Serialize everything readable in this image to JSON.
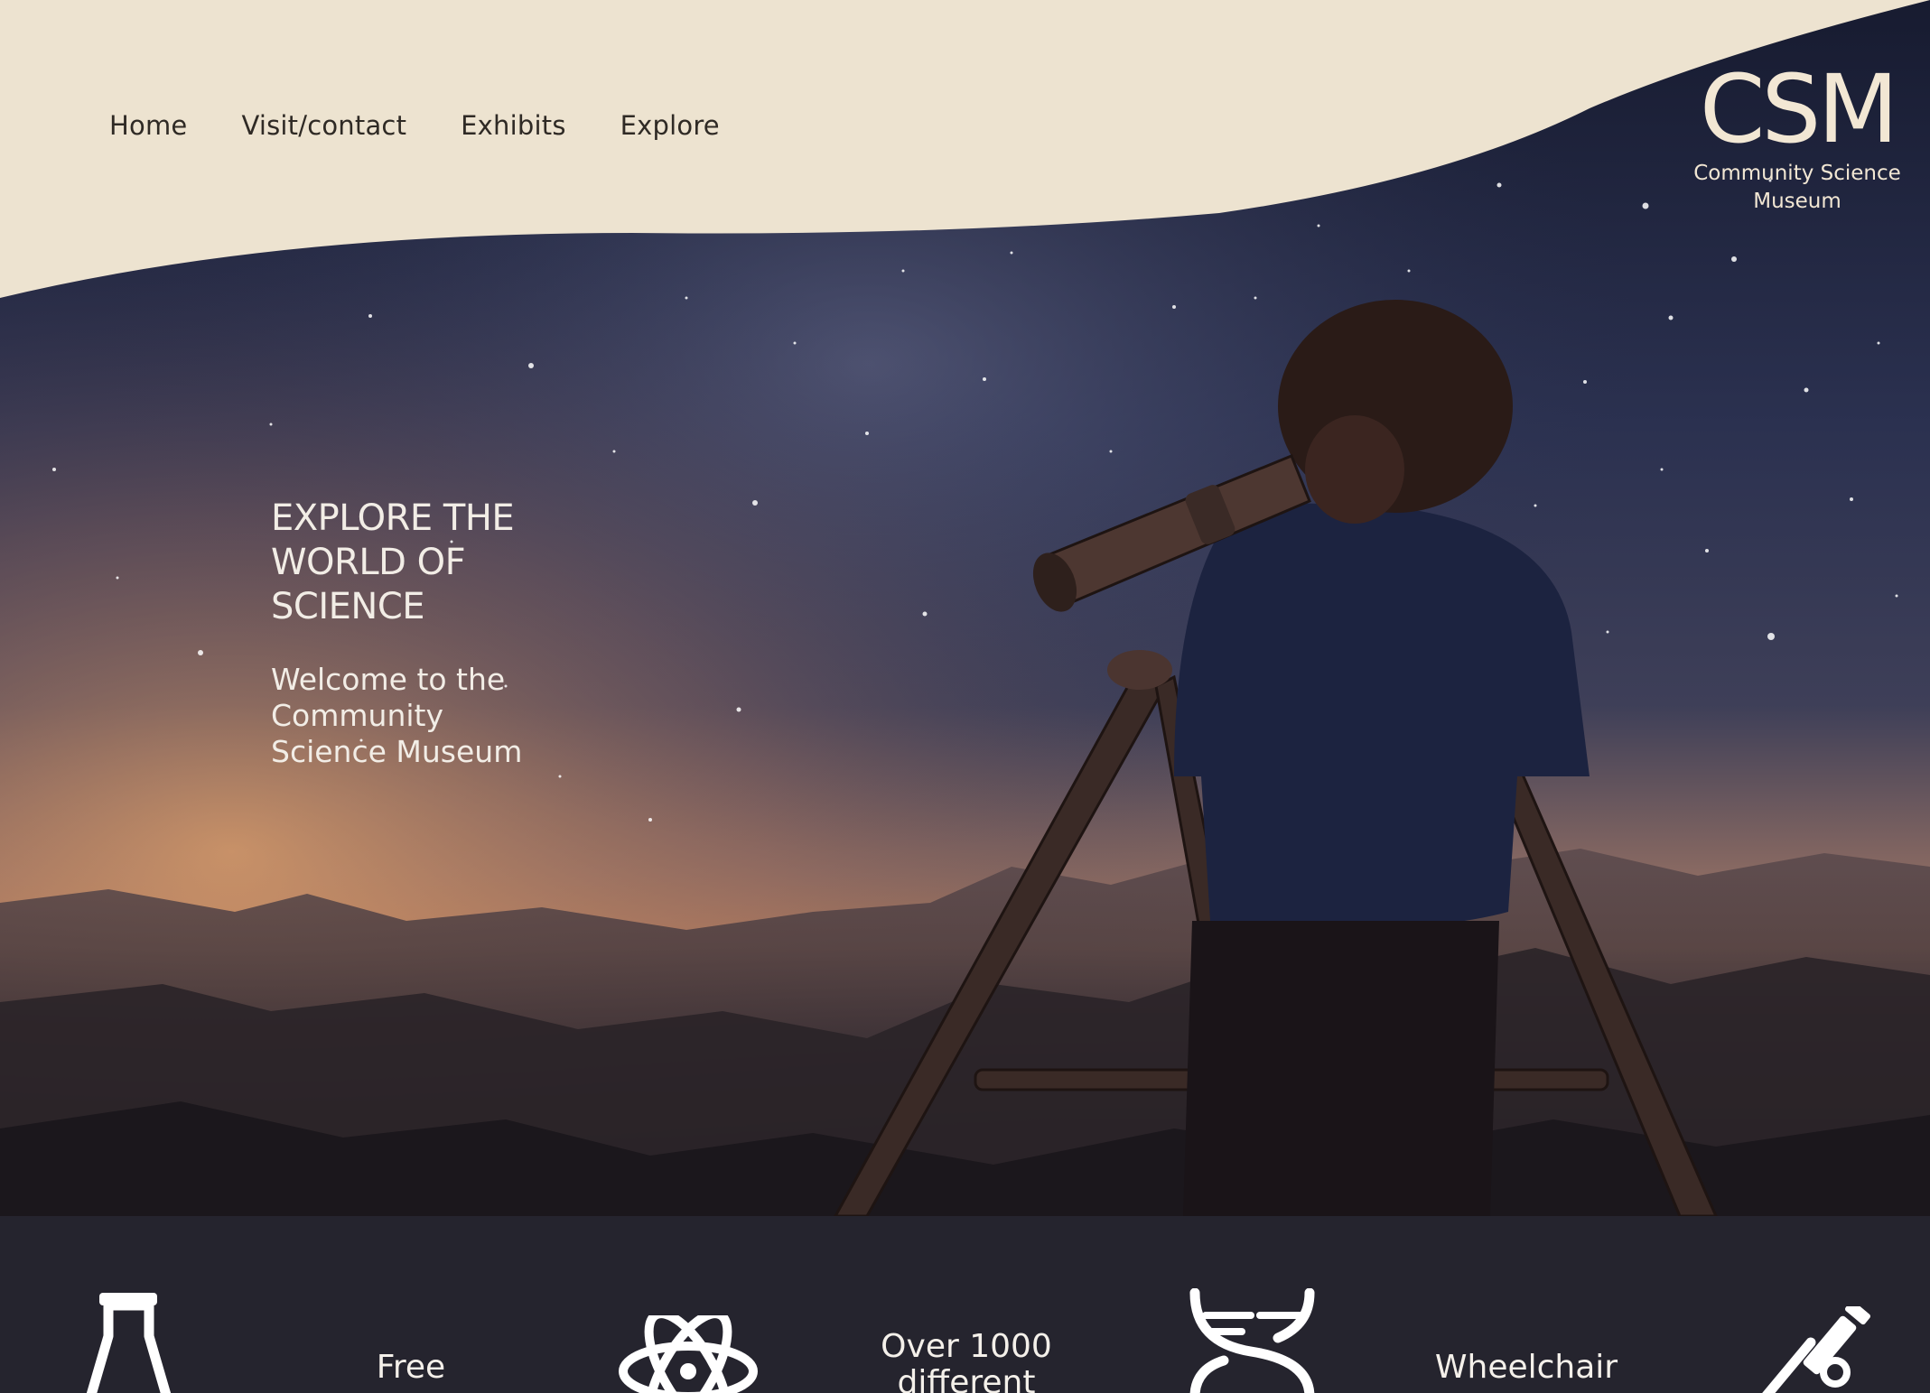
{
  "nav": {
    "items": [
      {
        "label": "Home"
      },
      {
        "label": "Visit/contact"
      },
      {
        "label": "Exhibits"
      },
      {
        "label": "Explore"
      }
    ]
  },
  "logo": {
    "mark": "CSM",
    "line1": "Community Science",
    "line2": "Museum"
  },
  "hero": {
    "title_line1": "EXPLORE THE",
    "title_line2": "WORLD OF",
    "title_line3": "SCIENCE",
    "subtitle": "Welcome to the Community Science Museum"
  },
  "features": [
    {
      "icon": "flask-icon",
      "text_line1": "Free",
      "text_line2": ""
    },
    {
      "icon": "atom-icon",
      "text_line1": "Over 1000",
      "text_line2": "different"
    },
    {
      "icon": "dna-icon",
      "text_line1": "Wheelchair",
      "text_line2": ""
    },
    {
      "icon": "microscope-icon"
    }
  ],
  "colors": {
    "header_cream": "#ede3d0",
    "strip_dark": "#25242e",
    "sky_dark": "#1c1f33",
    "horizon_glow": "#c98a5c"
  }
}
